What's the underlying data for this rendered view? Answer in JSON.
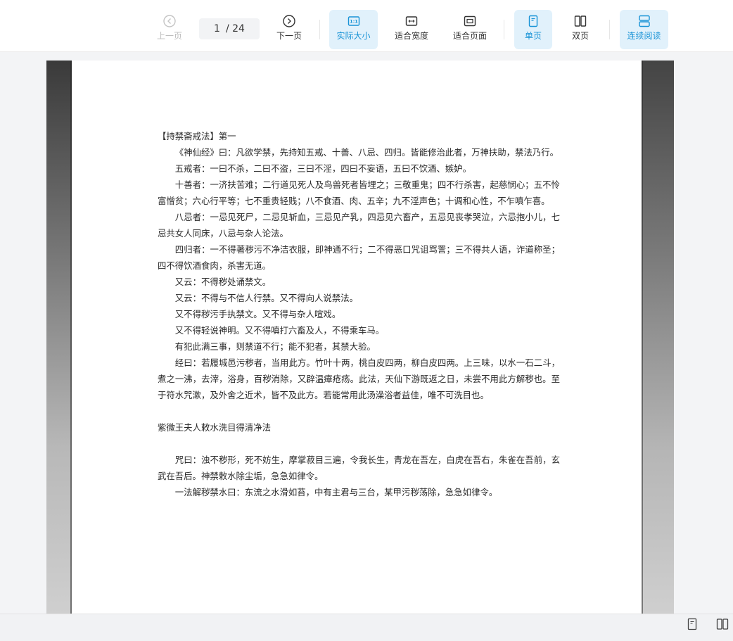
{
  "toolbar": {
    "prev_label": "上一页",
    "page_current": "1",
    "page_total": "/ 24",
    "next_label": "下一页",
    "actual_size_label": "实际大小",
    "fit_width_label": "适合宽度",
    "fit_page_label": "适合页面",
    "single_page_label": "单页",
    "double_page_label": "双页",
    "continuous_label": "连续阅读",
    "accent_color": "#1893d6",
    "active_bg": "#e1f1fb"
  },
  "document": {
    "paragraphs": [
      {
        "text": "【持禁斋戒法】第一",
        "indent": false
      },
      {
        "text": "《神仙经》曰：凡欲学禁，先持知五戒、十善、八忌、四归。皆能修治此者，万神扶助，禁法乃行。",
        "indent": true
      },
      {
        "text": "五戒者：一曰不杀，二曰不盗，三曰不淫，四曰不妄语，五曰不饮酒、嫉妒。",
        "indent": true
      },
      {
        "text": "十善者：一济扶苦难；二行道见死人及鸟兽死者皆埋之；三敬重鬼；四不行杀害，起慈悯心；五不怜富憎贫；六心行平等；七不重贵轻贱；八不食酒、肉、五辛；九不淫声色；十调和心性，不乍嗔乍喜。",
        "indent": true
      },
      {
        "text": "八忌者：一忌见死尸，二忌见斩血，三忌见产乳，四忌见六畜产，五忌见丧孝哭泣，六忌抱小儿，七忌共女人同床，八忌与杂人论法。",
        "indent": true
      },
      {
        "text": "四归者：一不得著秽污不净洁衣服，即神通不行；二不得恶口咒诅骂詈；三不得共人语，诈道称圣；四不得饮酒食肉，杀害无道。",
        "indent": true
      },
      {
        "text": "又云：不得秽处诵禁文。",
        "indent": true
      },
      {
        "text": "又云：不得与不信人行禁。又不得向人说禁法。",
        "indent": true
      },
      {
        "text": "又不得秽污手执禁文。又不得与杂人喧戏。",
        "indent": true
      },
      {
        "text": "又不得轻说神明。又不得嗔打六畜及人，不得乘车马。",
        "indent": true
      },
      {
        "text": "有犯此满三事，则禁道不行；能不犯者，其禁大验。",
        "indent": true
      },
      {
        "text": "经曰：若履城邑污秽者，当用此方。竹叶十两，桃白皮四两，柳白皮四两。上三味，以水一石二斗，煮之一沸，去滓，浴身，百秽消除，又辟温瘴疮疡。此法，天仙下游既返之日，未尝不用此方解秽也。至于符水咒漱，及外舍之近术，皆不及此方。若能常用此汤澡浴者益佳，唯不可洗目也。",
        "indent": true
      },
      {
        "text": "",
        "indent": false
      },
      {
        "text": "紫微王夫人敕水洗目得清净法",
        "indent": false
      },
      {
        "text": "",
        "indent": false
      },
      {
        "text": "咒曰：浊不秽形，死不妨生，摩掌菽目三遍，令我长生，青龙在吾左，白虎在吾右，朱雀在吾前，玄武在吾后。神禁敕水除尘垢，急急如律令。",
        "indent": true
      },
      {
        "text": "一法解秽禁水曰：东流之水滑如苔，中有主君与三台，某甲污秽荡除，急急如律令。",
        "indent": true
      }
    ]
  }
}
